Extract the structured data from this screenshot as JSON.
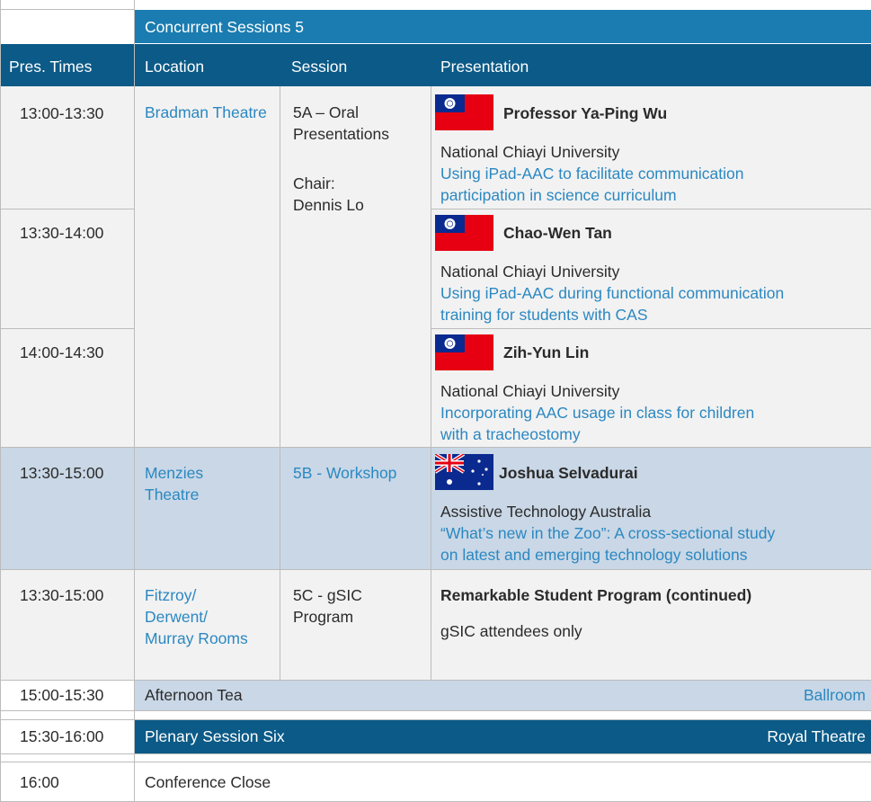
{
  "banner": {
    "title": "Concurrent Sessions 5"
  },
  "columns": {
    "times": "Pres. Times",
    "location": "Location",
    "session": "Session",
    "presentation": "Presentation"
  },
  "block_a": {
    "location": "Bradman Theatre",
    "session": "5A – Oral Presentations",
    "chair_label": "Chair:",
    "chair_name": "Dennis Lo",
    "rows": [
      {
        "time": "13:00-13:30",
        "flag": "taiwan-flag",
        "presenter": "Professor Ya-Ping Wu",
        "org": "National Chiayi University",
        "title_1": "Using iPad-AAC to facilitate communication",
        "title_2": "participation in science curriculum"
      },
      {
        "time": "13:30-14:00",
        "flag": "taiwan-flag",
        "presenter": "Chao-Wen Tan",
        "org": "National Chiayi University",
        "title_1": "Using iPad-AAC during functional communication",
        "title_2": "training for students with CAS"
      },
      {
        "time": "14:00-14:30",
        "flag": "taiwan-flag",
        "presenter": "Zih-Yun Lin",
        "org": "National Chiayi University",
        "title_1": "Incorporating AAC usage in class for children",
        "title_2": "with a tracheostomy"
      }
    ]
  },
  "block_b": {
    "time": "13:30-15:00",
    "location_1": "Menzies",
    "location_2": "Theatre",
    "session": "5B - Workshop",
    "flag": "australia-flag",
    "presenter": "Joshua Selvadurai",
    "org": "Assistive Technology Australia",
    "title_1": "“What’s new in the Zoo”: A cross-sectional study",
    "title_2": "on latest and emerging technology solutions"
  },
  "block_c": {
    "time": "13:30-15:00",
    "location_1": "Fitzroy/",
    "location_2": "Derwent/",
    "location_3": "Murray Rooms",
    "session_1": "5C - gSIC",
    "session_2": "Program",
    "presenter": "Remarkable Student Program (continued)",
    "note": "gSIC attendees only"
  },
  "tea": {
    "time": "15:00-15:30",
    "label": "Afternoon Tea",
    "venue": "Ballroom"
  },
  "plenary": {
    "time": "15:30-16:00",
    "label": "Plenary Session Six",
    "venue": "Royal Theatre"
  },
  "close": {
    "time": "16:00",
    "label": "Conference Close"
  },
  "colors": {
    "header": "#1a7cb0",
    "header_dark": "#0b5a87",
    "link": "#2b88c1",
    "light_blue_band": "#c9d7e6",
    "grey_band": "#f2f2f2"
  }
}
